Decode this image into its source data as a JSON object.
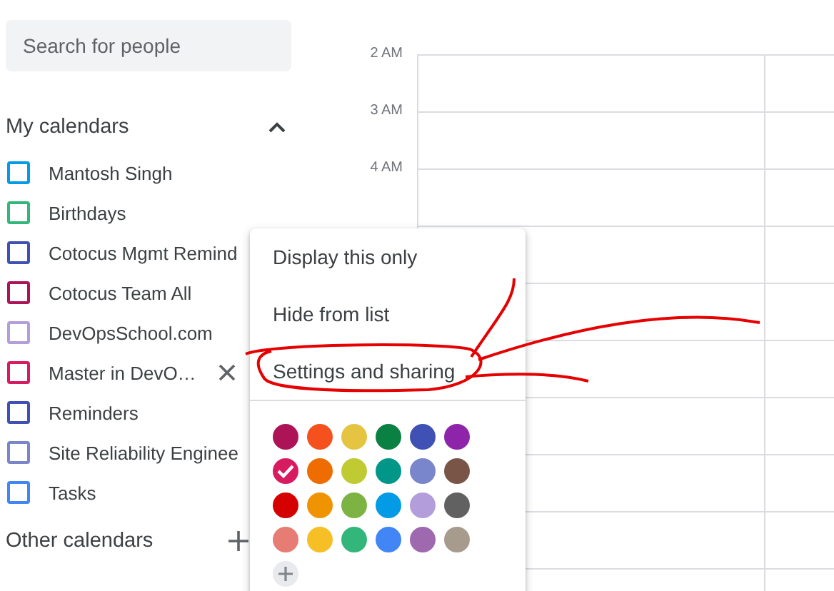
{
  "search": {
    "placeholder": "Search for people"
  },
  "my_calendars": {
    "title": "My calendars",
    "expanded": true,
    "items": [
      {
        "name": "Mantosh Singh",
        "color": "#039be5",
        "checked": false
      },
      {
        "name": "Birthdays",
        "color": "#33b679",
        "checked": false
      },
      {
        "name": "Cotocus Mgmt Remind",
        "color": "#3f51b5",
        "checked": false
      },
      {
        "name": "Cotocus Team All",
        "color": "#ad1457",
        "checked": false
      },
      {
        "name": "DevOpsSchool.com",
        "color": "#b39ddb",
        "checked": false
      },
      {
        "name": "Master in DevO…",
        "color": "#d81b60",
        "checked": false,
        "hovered": true
      },
      {
        "name": "Reminders",
        "color": "#3f51b5",
        "checked": false
      },
      {
        "name": "Site Reliability Enginee",
        "color": "#7986cb",
        "checked": false
      },
      {
        "name": "Tasks",
        "color": "#4285f4",
        "checked": false
      }
    ]
  },
  "other_calendars": {
    "title": "Other calendars"
  },
  "time_labels": [
    "2 AM",
    "3 AM",
    "4 AM"
  ],
  "menu": {
    "items": [
      "Display this only",
      "Hide from list",
      "Settings and sharing"
    ],
    "colors": [
      {
        "color": "#ad1457",
        "selected": false
      },
      {
        "color": "#f4511e",
        "selected": false
      },
      {
        "color": "#e4c441",
        "selected": false
      },
      {
        "color": "#0b8043",
        "selected": false
      },
      {
        "color": "#3f51b5",
        "selected": false
      },
      {
        "color": "#8e24aa",
        "selected": false
      },
      {
        "color": "#d81b60",
        "selected": true
      },
      {
        "color": "#ef6c00",
        "selected": false
      },
      {
        "color": "#c0ca33",
        "selected": false
      },
      {
        "color": "#009688",
        "selected": false
      },
      {
        "color": "#7986cb",
        "selected": false
      },
      {
        "color": "#795548",
        "selected": false
      },
      {
        "color": "#d50000",
        "selected": false
      },
      {
        "color": "#f09300",
        "selected": false
      },
      {
        "color": "#7cb342",
        "selected": false
      },
      {
        "color": "#039be5",
        "selected": false
      },
      {
        "color": "#b39ddb",
        "selected": false
      },
      {
        "color": "#616161",
        "selected": false
      },
      {
        "color": "#e67c73",
        "selected": false
      },
      {
        "color": "#f6bf26",
        "selected": false
      },
      {
        "color": "#33b679",
        "selected": false
      },
      {
        "color": "#4285f4",
        "selected": false
      },
      {
        "color": "#9e69af",
        "selected": false
      },
      {
        "color": "#a79b8e",
        "selected": false
      }
    ]
  }
}
